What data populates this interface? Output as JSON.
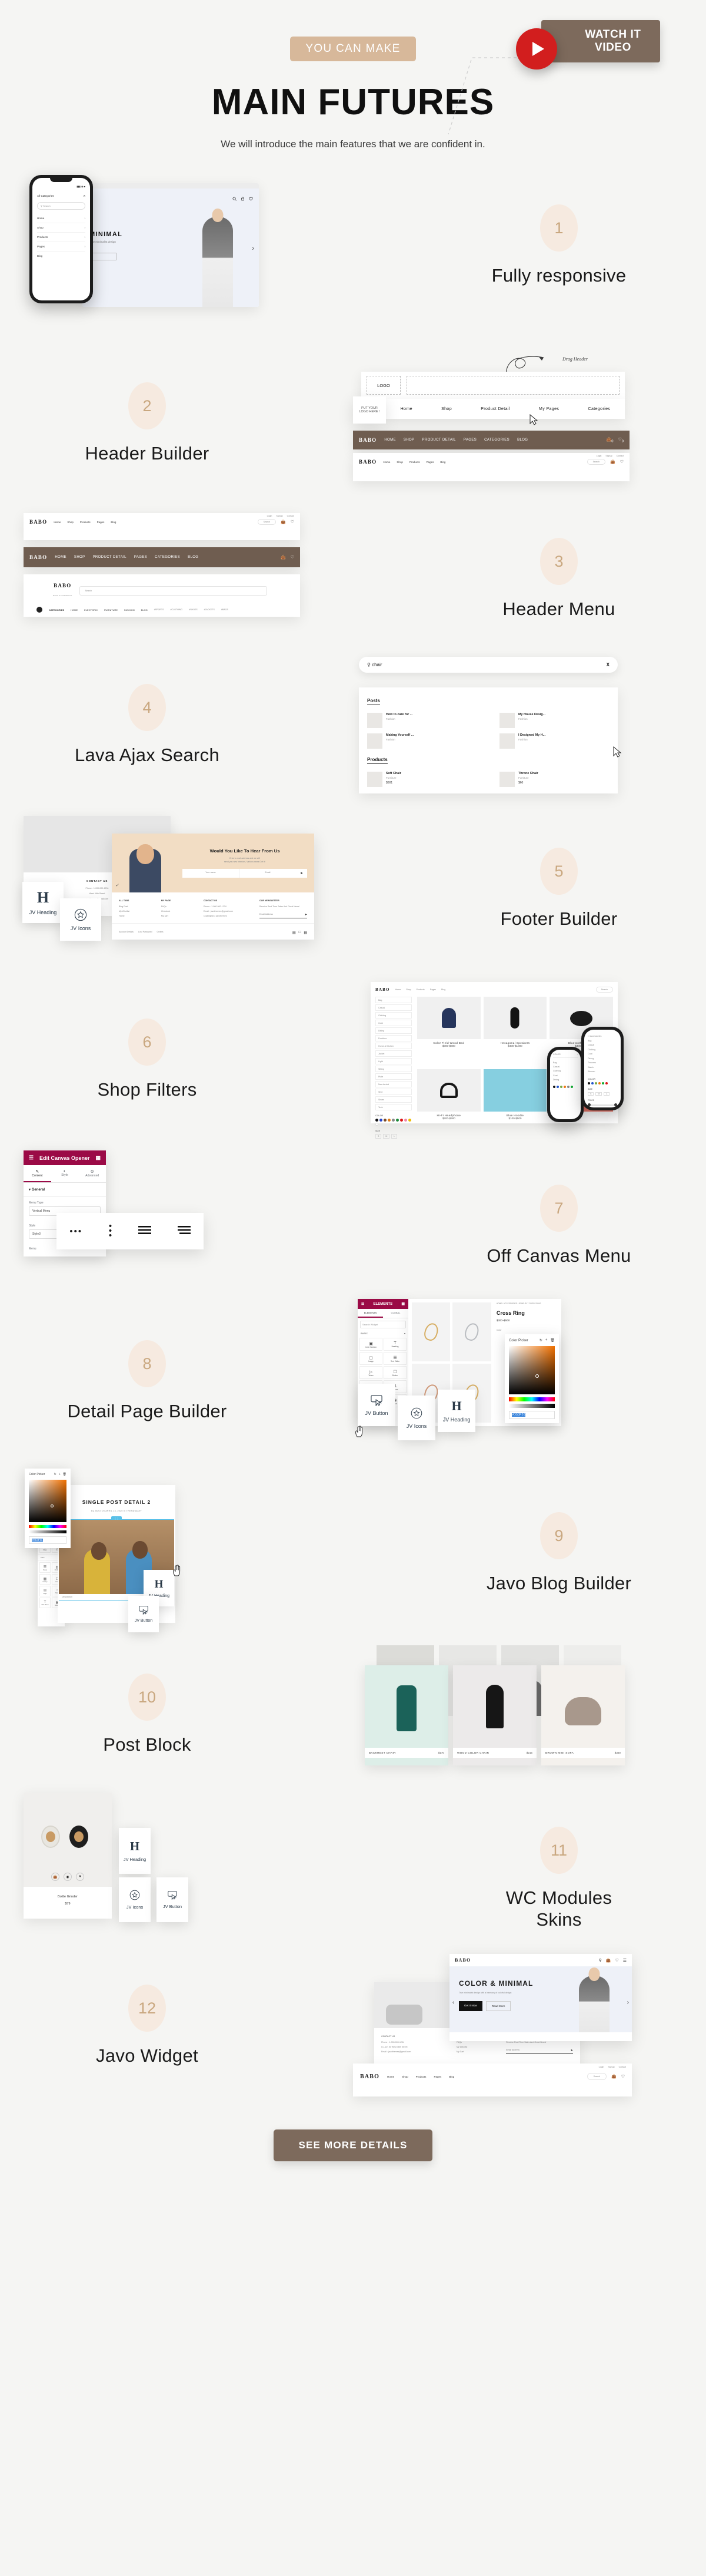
{
  "header": {
    "badge": "YOU CAN MAKE",
    "title": "MAIN FUTURES",
    "subtitle": "We will introduce the main features that we are confident in.",
    "watch_label": "WATCH IT\nVIDEO",
    "play_icon": "play-icon"
  },
  "colors": {
    "background": "#f5f5f3",
    "badge_bg": "#d7b89a",
    "brown": "#7d6a5c",
    "bubble_bg": "#f6eae0",
    "bubble_text": "#c9a77f",
    "play_red": "#d21e1e",
    "elementor_magenta": "#9b0a46",
    "navbar_dark": "#6f5d50"
  },
  "features": [
    {
      "num": "1",
      "label": "Fully responsive"
    },
    {
      "num": "2",
      "label": "Header Builder"
    },
    {
      "num": "3",
      "label": "Header Menu"
    },
    {
      "num": "4",
      "label": "Lava Ajax Search"
    },
    {
      "num": "5",
      "label": "Footer Builder"
    },
    {
      "num": "6",
      "label": "Shop Filters"
    },
    {
      "num": "7",
      "label": "Off Canvas Menu"
    },
    {
      "num": "8",
      "label": "Detail Page Builder"
    },
    {
      "num": "9",
      "label": "Javo Blog Builder"
    },
    {
      "num": "10",
      "label": "Post Block"
    },
    {
      "num": "11",
      "label": "WC Modules\nSkins"
    },
    {
      "num": "12",
      "label": "Javo Widget"
    }
  ],
  "phone": {
    "categories_title": "All Categories",
    "close": "X",
    "search_placeholder": "Search",
    "menu": [
      "Home",
      "Shop",
      "Products",
      "Pages",
      "Blog"
    ]
  },
  "hero_shot": {
    "title": "MINIMAL",
    "subtitle": "True minimalist design"
  },
  "header_builder": {
    "logo_placeholder": "LOGO",
    "drop_hint": "PUT YOUR\nLOGO HERE !",
    "drag_annotation": "Drag Header",
    "menu": [
      "Home",
      "Shop",
      "Product Detail",
      "My Pages",
      "Categories"
    ],
    "dark_nav": [
      "HOME",
      "SHOP",
      "PRODUCT DETAIL",
      "PAGES",
      "CATEGORIES",
      "BLOG"
    ],
    "brand": "BABO",
    "top_links": [
      "Login",
      "Signup",
      "Contact"
    ],
    "light_nav": [
      "Home",
      "Shop",
      "Products",
      "Pages",
      "Blog"
    ],
    "search_placeholder": "Search",
    "cart_count": "0",
    "wish_count": "0"
  },
  "header_menu": {
    "brand": "BABO",
    "brand_sub": "BABO ECOMMERCE",
    "search_placeholder": "Search",
    "categories_label": "CATEGORIES",
    "nav": [
      "HOME",
      "ELECTORIC",
      "FURNITURE",
      "FASHION",
      "BLOG"
    ],
    "tags": [
      "#SPORTS",
      "#CLOTHING",
      "#SHOES",
      "#JACKETS",
      "#BAGS"
    ]
  },
  "ajax_search": {
    "query": "chair",
    "close": "X",
    "posts_label": "Posts",
    "products_label": "Products",
    "posts": [
      {
        "title": "How to care for ...",
        "cat": "Fashion"
      },
      {
        "title": "My House Desig...",
        "cat": "Fashion"
      },
      {
        "title": "Making Yourself ...",
        "cat": "Fashion"
      },
      {
        "title": "I Designed My H...",
        "cat": "Fashion"
      }
    ],
    "products": [
      {
        "title": "Soft Chair",
        "cat": "Furniture",
        "price": "$601"
      },
      {
        "title": "Throne Chair",
        "cat": "Furniture",
        "price": "$60"
      }
    ]
  },
  "footer_builder": {
    "newsletter_title": "Would You Like To Hear From Us",
    "newsletter_desc": "Enter e-mail address and we will\nsend you new Interiors, Various news Get it!",
    "name_placeholder": "Your name",
    "email_placeholder": "Email",
    "contact_title": "CONTACT US",
    "contact_phone": "Phone : 1-000-000-1234",
    "contact_addr": "West 46th Street",
    "contact_mail": "javothemes@gmail.com",
    "cols": [
      {
        "head": "ALL TABS",
        "items": [
          "Blog Post",
          "My Wishlist",
          "Home"
        ]
      },
      {
        "head": "MY PAGE",
        "items": [
          "FAQs",
          "Checkout",
          "My cart"
        ]
      },
      {
        "head": "CONTACT US",
        "items": [
          "Phone : 1-000-000-1234",
          "Email : javothemes@gmail.com",
          "Copyright(C) javothemes"
        ]
      },
      {
        "head": "OUR NEWSLETTER",
        "items": [
          "Receive Real Time Sales And Great News!"
        ]
      }
    ],
    "news_placeholder": "Email Address",
    "bottom_links": [
      "Account Details",
      "Lost Password",
      "Orders"
    ],
    "widgets": [
      "JV Heading",
      "JV Icons"
    ]
  },
  "shop_filters": {
    "brand": "BABO",
    "nav": [
      "Home",
      "Shop",
      "Products",
      "Pages",
      "Blog"
    ],
    "search_placeholder": "Search",
    "filters": [
      "Bag",
      "Casual",
      "Clothing",
      "Coat",
      "Dining",
      "Furniture",
      "Home & Kitchen",
      "Jacket",
      "Light",
      "Sitting",
      "Plate",
      "New Arrival",
      "Shirt",
      "Shoes",
      "Tech",
      "Trousers",
      "Watch",
      "Women"
    ],
    "color_label": "COLOR",
    "size_label": "SIZE",
    "sizes": [
      "S",
      "M",
      "L"
    ],
    "price_label": "PRICE",
    "products": [
      {
        "name": "Color Field Wood Bed",
        "price": "$300-$800"
      },
      {
        "name": "Hexagonal Speakers",
        "price": "$400-$1000"
      },
      {
        "name": "Bluetooth Speaker",
        "price": "$300-$800"
      },
      {
        "name": "Hi-Fi Headphone",
        "price": "$200-$900"
      },
      {
        "name": "Blue Hoodie",
        "price": "$100-$500"
      }
    ]
  },
  "canvas_opener": {
    "panel_title": "Edit Canvas Opener",
    "tabs": [
      "Content",
      "Style",
      "Advanced"
    ],
    "section": "General",
    "fields": [
      {
        "label": "Menu Type",
        "value": "Vertical Menu"
      },
      {
        "label": "Style",
        "value": "Style3"
      },
      {
        "label": "Menu",
        "value": ""
      }
    ],
    "icon_styles": [
      "dots-horizontal-icon",
      "dots-vertical-icon",
      "hamburger-icon",
      "hamburger-wide-icon"
    ]
  },
  "detail_builder": {
    "breadcrumb": "HOME / ACCESSORIES / JEWELRY / CROSS RING",
    "product_title": "Cross Ring",
    "product_price": "$300~$500",
    "color_label": "Color",
    "search_placeholder": "Search Widget",
    "group_label": "BASIC",
    "widgets": [
      "Inner Section",
      "Heading",
      "Image",
      "Text Editor",
      "Video",
      "Button",
      "Divider",
      "Spacer",
      "Google Maps",
      "Icon"
    ],
    "color_picker_title": "Color Picker",
    "hex_value": "#D53F26",
    "cards": [
      "JV Button",
      "JV Icons",
      "JV Heading"
    ]
  },
  "blog_builder": {
    "post_title": "SINGLE POST DETAIL 2",
    "post_meta": "By JAVO   On APRIL 13, 2020   In TRENDS&DIY",
    "caption": "Description",
    "color_picker_title": "Color Picker",
    "hex_value": "#D53F26",
    "cards": [
      "JV Heading",
      "JV Button"
    ]
  },
  "post_block": {
    "items": [
      {
        "name": "BACKREST CHAIR",
        "price": "$170"
      },
      {
        "name": "WOOD COLOR CHAIR",
        "price": "$215"
      },
      {
        "name": "BROWN MINI SOFA",
        "price": "$330"
      }
    ]
  },
  "wc_modules": {
    "product_name": "Bottle Grinder",
    "product_price": "$79",
    "action_icons": [
      "cart-icon",
      "compare-icon",
      "heart-icon"
    ],
    "cards": [
      "JV Heading",
      "JV Icons",
      "JV Button"
    ]
  },
  "javo_widget": {
    "brand": "BABO",
    "hero_title": "COLOR & MINIMAL",
    "hero_desc": "True minimalist design with a harmony of colorful design",
    "btn_primary": "Get It Now",
    "btn_secondary": "Read More",
    "nav": [
      "Home",
      "Shop",
      "Products",
      "Pages",
      "Blog"
    ],
    "top_links": [
      "Login",
      "Signup",
      "Contact"
    ],
    "search_placeholder": "Search",
    "footer_cols": [
      {
        "head": "CONTACT US",
        "items": [
          "Phone : 1-000-000-1234",
          "U-14/2, 50 West 46th Street",
          "Email : javothemes@gmail.com"
        ]
      },
      {
        "head": "MY PAGE",
        "items": [
          "FAQs",
          "My Wishlist",
          "My Cart"
        ]
      },
      {
        "head": "OUR NEWSLETTER",
        "items": [
          "Receive Real Time Sales And Great News!"
        ]
      }
    ],
    "news_placeholder": "Email Address"
  },
  "cta": {
    "label": "SEE MORE DETAILS"
  }
}
